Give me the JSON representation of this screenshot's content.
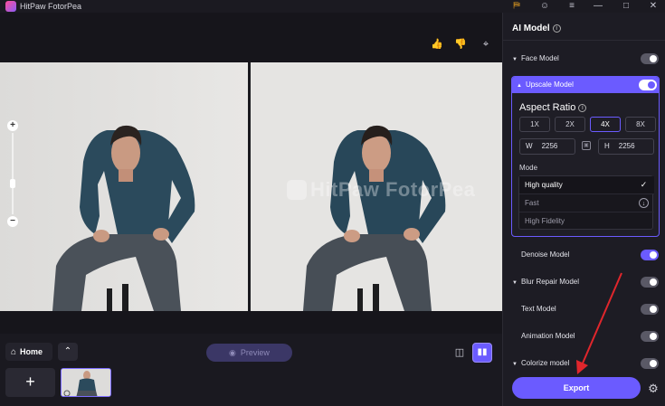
{
  "app": {
    "title": "HitPaw FotorPea"
  },
  "titlebar": {
    "icons": [
      "basket-icon",
      "user-icon",
      "menu-icon",
      "minimize-icon",
      "maximize-icon",
      "close-icon"
    ]
  },
  "canvas": {
    "tools": [
      "thumbs-up-icon",
      "thumbs-down-icon",
      "crop-icon"
    ],
    "watermark": "HitPaw FotorPea"
  },
  "bottom": {
    "home_label": "Home",
    "preview_label": "Preview",
    "add_symbol": "+"
  },
  "panel": {
    "title": "AI Model",
    "models": [
      {
        "name": "Face Model",
        "enabled": false
      },
      {
        "name": "Upscale Model",
        "enabled": true
      },
      {
        "name": "Denoise Model",
        "enabled": true
      },
      {
        "name": "Blur Repair Model",
        "enabled": false
      },
      {
        "name": "Text Model",
        "enabled": false
      },
      {
        "name": "Animation Model",
        "enabled": false
      },
      {
        "name": "Colorize model",
        "enabled": false
      }
    ],
    "upscale": {
      "aspect_title": "Aspect Ratio",
      "ratios": [
        "1X",
        "2X",
        "4X",
        "8X"
      ],
      "selected_ratio": "4X",
      "width_label": "W",
      "width_value": "2256",
      "height_label": "H",
      "height_value": "2256",
      "mode_label": "Mode",
      "modes": [
        "High quality",
        "Fast",
        "High Fidelity"
      ],
      "selected_mode": "High quality"
    },
    "export_label": "Export"
  },
  "colors": {
    "accent": "#6b5bff",
    "background": "#141318",
    "panel": "#1d1c24",
    "annotation_arrow": "#e0262c"
  }
}
